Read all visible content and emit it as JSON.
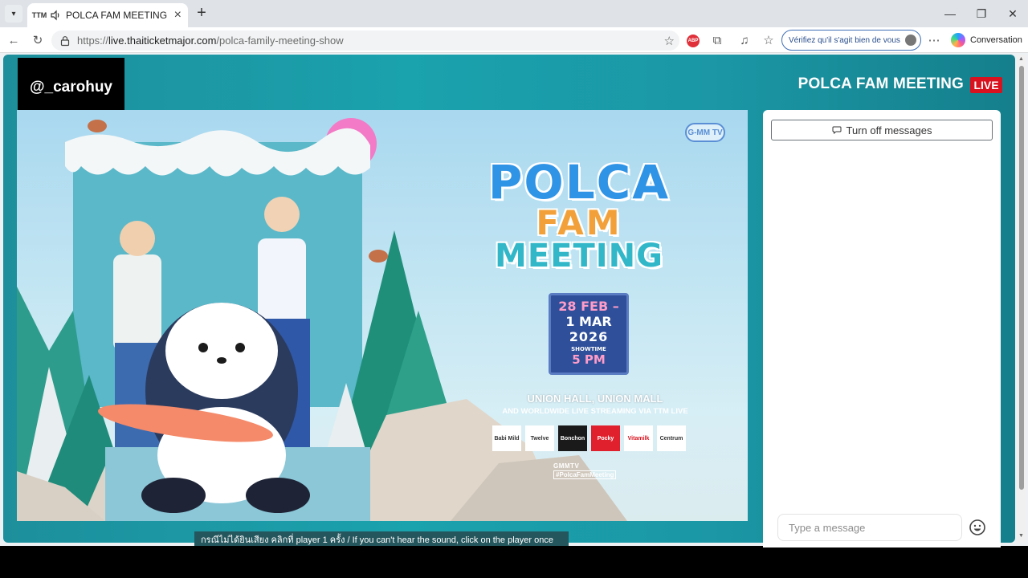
{
  "browser": {
    "tab": {
      "favicon_text": "TTM",
      "title": "POLCA FAM MEETING"
    },
    "url": {
      "prefix": "https://",
      "host": "live.thaiticketmajor.com",
      "path": "/polca-family-meeting-show"
    },
    "verify_pill": "Vérifiez qu'il s'agit bien de vous",
    "conversation_label": "Conversation",
    "abp_label": "ABP"
  },
  "page": {
    "watermark": "@_carohuy",
    "show_title": "POLCA FAM MEETING",
    "live_badge": "LIVE",
    "sound_hint": "กรณีไม่ได้ยินเสียง คลิกที่ player 1 ครั้ง / If you can't hear the sound, click on the player once"
  },
  "poster": {
    "brand": "G-MM TV",
    "logo": {
      "line1": "POLCA",
      "line2": "FAM",
      "line3": "MEETING"
    },
    "date": {
      "line1": "28 FEB –",
      "line2": "1 MAR",
      "line3": "2026",
      "showtime_label": "SHOWTIME",
      "time": "5 PM"
    },
    "venue": "UNION HALL, UNION MALL",
    "venue_sub": "AND WORLDWIDE LIVE STREAMING VIA TTM LIVE",
    "sponsors": [
      "Babi Mild",
      "Twelve",
      "Bonchon",
      "Pocky",
      "Vitamilk",
      "Centrum"
    ],
    "social": "GMMTV",
    "hashtag": "#PolcaFamMeeting"
  },
  "chat": {
    "toggle_label": "Turn off messages",
    "input_placeholder": "Type a message"
  },
  "colors": {
    "stage": "#1aa2ad",
    "live": "#d8121e",
    "tab_bg": "#dfe3e8"
  }
}
